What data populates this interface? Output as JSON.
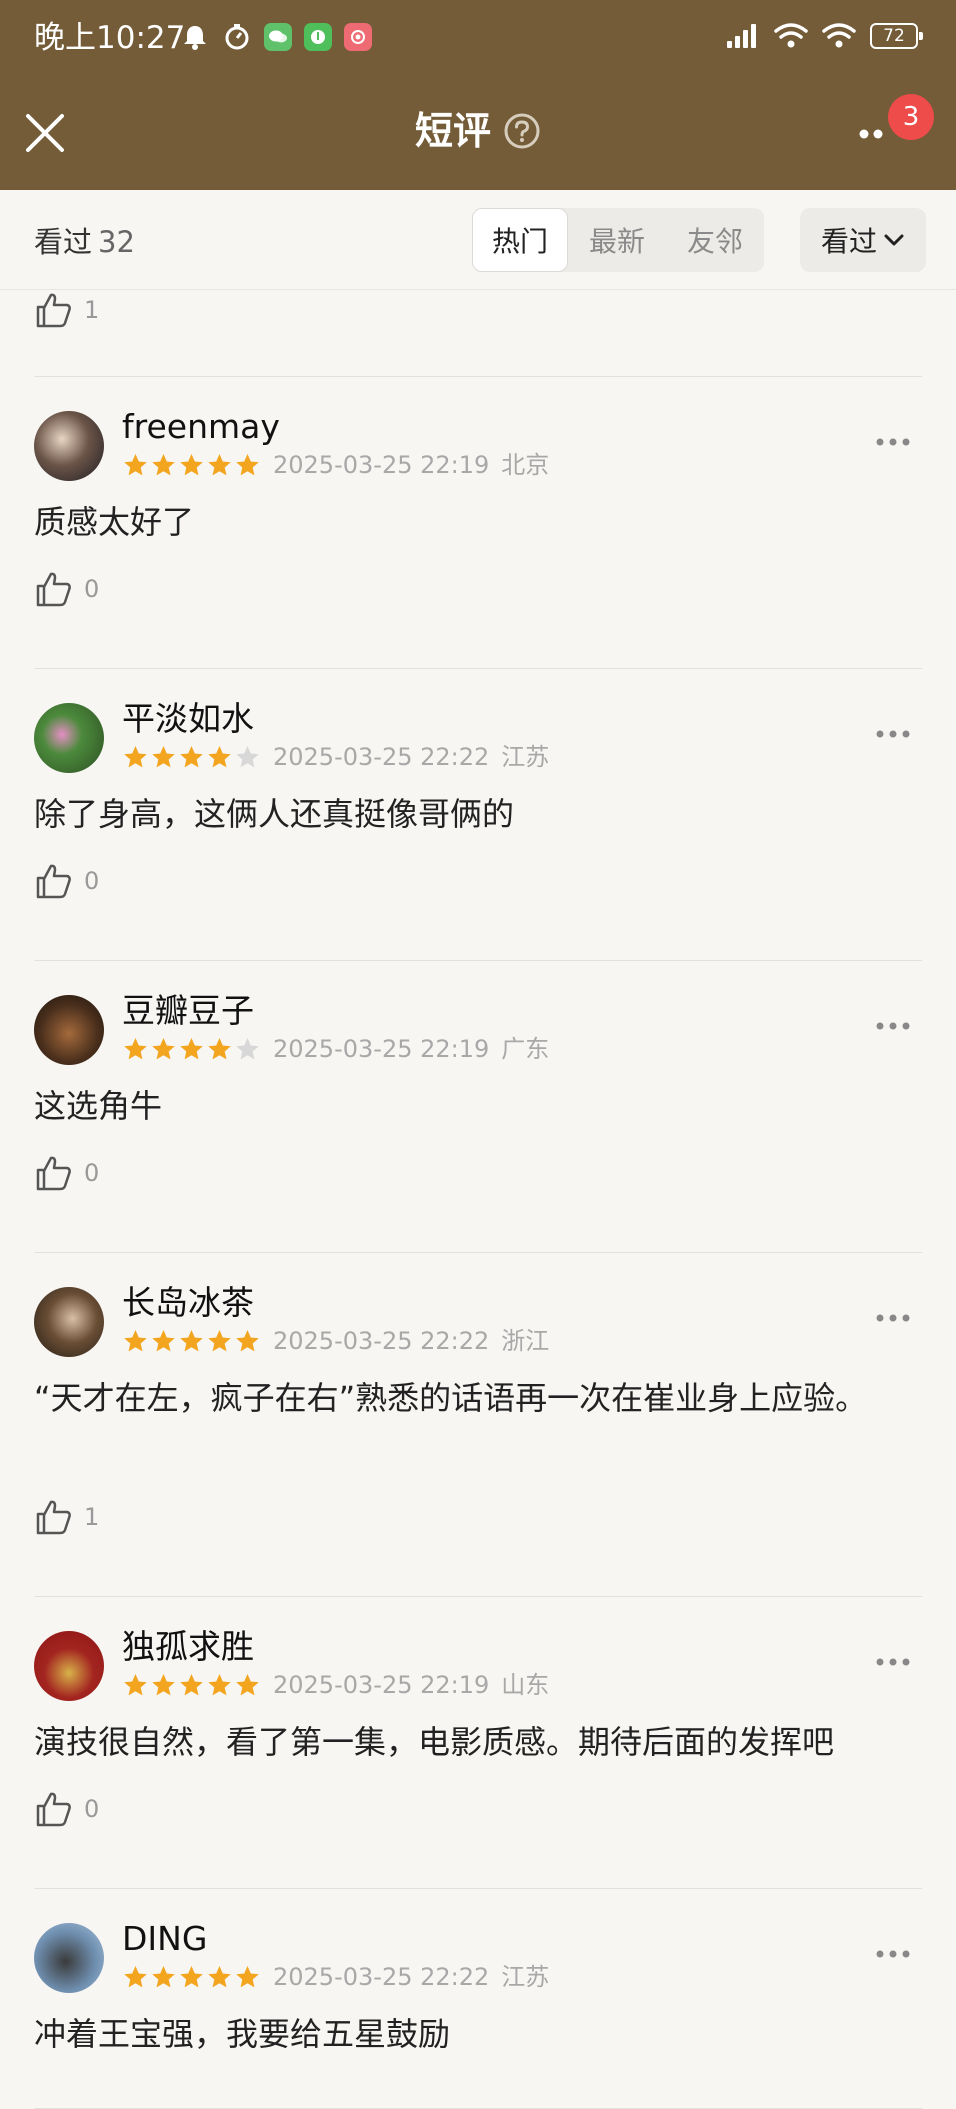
{
  "status_bar": {
    "time": "晚上10:27",
    "battery": "72",
    "left_icons": [
      "alarm-icon",
      "timer-icon",
      "wechat-icon",
      "app-icon",
      "record-icon"
    ],
    "right_icons": [
      "signal-icon",
      "wifi-icon",
      "wifi-icon",
      "battery-icon"
    ]
  },
  "nav": {
    "title": "短评",
    "more_badge": "3"
  },
  "filter": {
    "watched_label": "看过",
    "watched_count": "32",
    "tabs": [
      "热门",
      "最新",
      "友邻"
    ],
    "active_tab": "热门",
    "select_label": "看过"
  },
  "top_partial": {
    "likes": "1"
  },
  "comments": [
    {
      "user": "freenmay",
      "rating": 5,
      "time": "2025-03-25 22:19",
      "location": "北京",
      "text": "质感太好了",
      "likes": "0"
    },
    {
      "user": "平淡如水",
      "rating": 4,
      "time": "2025-03-25 22:22",
      "location": "江苏",
      "text": "除了身高，这俩人还真挺像哥俩的",
      "likes": "0"
    },
    {
      "user": "豆瓣豆子",
      "rating": 4,
      "time": "2025-03-25 22:19",
      "location": "广东",
      "text": "这选角牛",
      "likes": "0"
    },
    {
      "user": "长岛冰茶",
      "rating": 5,
      "time": "2025-03-25 22:22",
      "location": "浙江",
      "text": "“天才在左，疯子在右”熟悉的话语再一次在崔业身上应验。",
      "likes": "1"
    },
    {
      "user": "独孤求胜",
      "rating": 5,
      "time": "2025-03-25 22:19",
      "location": "山东",
      "text": "演技很自然，看了第一集，电影质感。期待后面的发挥吧",
      "likes": "0"
    },
    {
      "user": "DING",
      "rating": 5,
      "time": "2025-03-25 22:22",
      "location": "江苏",
      "text": "冲着王宝强，我要给五星鼓励",
      "likes": ""
    }
  ],
  "colors": {
    "header_bg": "#735c37",
    "star_on": "#f3a51f",
    "star_off": "#d8d8d8",
    "badge": "#ee4b4b"
  }
}
